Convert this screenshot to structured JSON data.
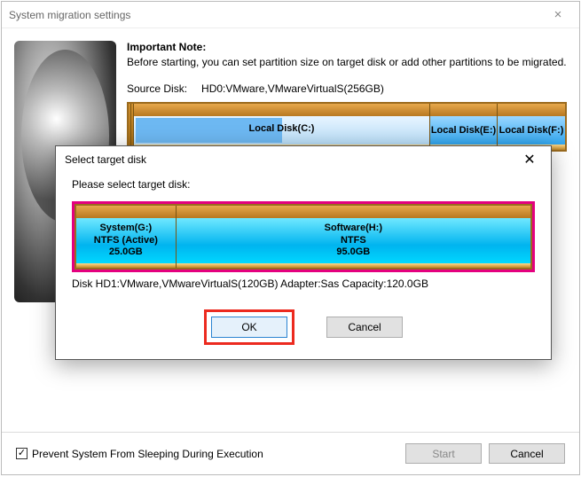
{
  "window": {
    "title": "System migration settings",
    "close": "×"
  },
  "note": {
    "title": "Important Note:",
    "text": "Before starting, you can set partition size on target disk or add other partitions to be migrated."
  },
  "source": {
    "label": "Source Disk:",
    "value": "HD0:VMware,VMwareVirtualS(256GB)",
    "partitions": {
      "c": "Local Disk(C:)",
      "e": "Local Disk(E:)",
      "f": "Local Disk(F:)"
    }
  },
  "footer": {
    "checkbox_label": "Prevent System From Sleeping During Execution",
    "checkmark": "✓",
    "start": "Start",
    "cancel": "Cancel"
  },
  "dialog": {
    "title": "Select target disk",
    "close": "✕",
    "prompt": "Please select target disk:",
    "part_a": {
      "line1": "System(G:)",
      "line2": "NTFS (Active)",
      "line3": "25.0GB"
    },
    "part_b": {
      "line1": "Software(H:)",
      "line2": "NTFS",
      "line3": "95.0GB"
    },
    "info": "Disk HD1:VMware,VMwareVirtualS(120GB)  Adapter:Sas  Capacity:120.0GB",
    "ok": "OK",
    "cancel": "Cancel"
  }
}
